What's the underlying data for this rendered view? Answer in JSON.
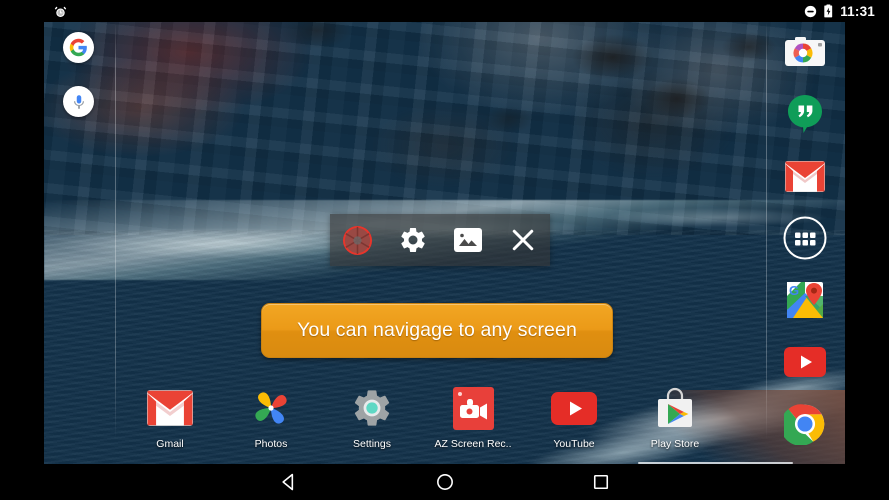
{
  "status_bar": {
    "left_icons": [
      {
        "name": "alarm-icon",
        "glyph": "alarm"
      }
    ],
    "right_icons": [
      {
        "name": "do-not-disturb-icon",
        "glyph": "dnd"
      },
      {
        "name": "battery-charging-icon",
        "glyph": "battery-charging"
      }
    ],
    "time": "11:31"
  },
  "search_widget": {
    "google_logo_label": "G",
    "mic_label": "microphone"
  },
  "app_rail": [
    {
      "name": "camera",
      "label": "Camera"
    },
    {
      "name": "hangouts",
      "label": "Hangouts"
    },
    {
      "name": "gmail",
      "label": "Gmail"
    },
    {
      "name": "app-drawer",
      "label": "Apps"
    },
    {
      "name": "maps",
      "label": "Maps"
    },
    {
      "name": "youtube",
      "label": "YouTube"
    },
    {
      "name": "chrome",
      "label": "Chrome"
    }
  ],
  "floating_toolbar": {
    "buttons": [
      {
        "name": "record-button",
        "label": "Record"
      },
      {
        "name": "settings-button",
        "label": "Settings"
      },
      {
        "name": "gallery-button",
        "label": "Gallery"
      },
      {
        "name": "close-button",
        "label": "Close"
      }
    ]
  },
  "toast": {
    "message": "You can navigage to any screen",
    "background_color": "#eb9a18",
    "text_color": "#ffffff"
  },
  "dock": [
    {
      "name": "gmail",
      "label": "Gmail"
    },
    {
      "name": "photos",
      "label": "Photos"
    },
    {
      "name": "settings",
      "label": "Settings"
    },
    {
      "name": "az-screen-rec",
      "label": "AZ Screen Rec.."
    },
    {
      "name": "youtube",
      "label": "YouTube"
    },
    {
      "name": "play-store",
      "label": "Play Store"
    }
  ],
  "nav_bar": {
    "back_label": "Back",
    "home_label": "Home",
    "recents_label": "Recent apps"
  },
  "colors": {
    "accent_orange": "#eb9a18",
    "record_red": "#e8352b",
    "system_black": "#000000",
    "wallpaper_land": "#8a5246",
    "wallpaper_ocean": "#154a66"
  }
}
